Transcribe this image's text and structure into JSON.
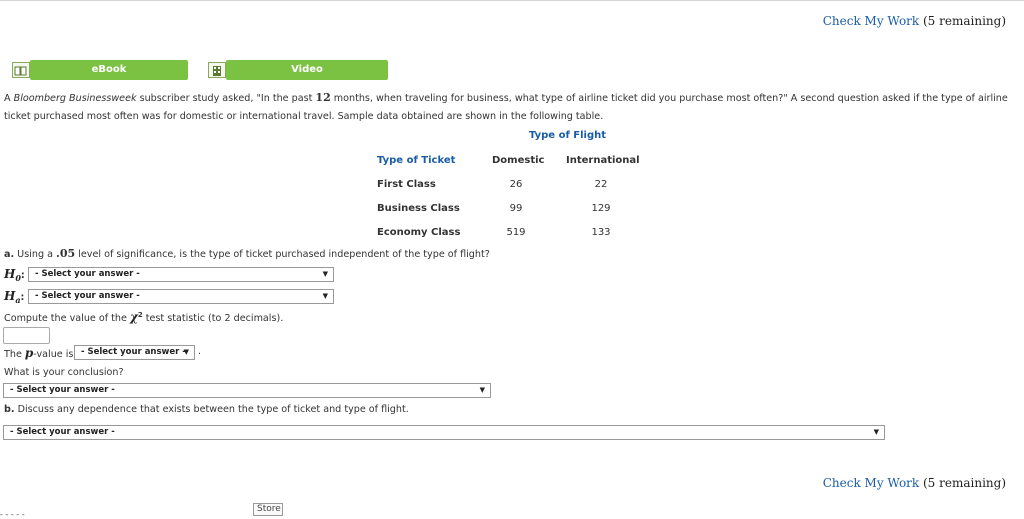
{
  "check_work": {
    "link": "Check My Work",
    "remaining": "(5 remaining)"
  },
  "resources": {
    "ebook": "eBook",
    "video": "Video"
  },
  "problem": {
    "intro_prefix": "A ",
    "publication": "Bloomberg Businessweek",
    "intro_mid": " subscriber study asked, \"In the past ",
    "months": "12",
    "intro_rest": " months, when traveling for business, what type of airline ticket did you purchase most often?\" A second question asked if the type of airline ticket purchased most often was for domestic or international travel. Sample data obtained are shown in the following table."
  },
  "table": {
    "group_header": "Type of Flight",
    "row_header": "Type of Ticket",
    "columns": [
      "Domestic",
      "International"
    ],
    "rows": [
      {
        "label": "First Class",
        "values": [
          "26",
          "22"
        ]
      },
      {
        "label": "Business Class",
        "values": [
          "99",
          "129"
        ]
      },
      {
        "label": "Economy Class",
        "values": [
          "519",
          "133"
        ]
      }
    ]
  },
  "part_a": {
    "letter": "a.",
    "question_pre": " Using a ",
    "alpha": ".05",
    "question_post": " level of significance, is the type of ticket purchased independent of the type of flight?",
    "h0_symbol": "H",
    "h0_sub": "0",
    "ha_symbol": "H",
    "ha_sub": "a",
    "h0_select": "- Select your answer -",
    "ha_select": "- Select your answer -",
    "chi_prompt_pre": "Compute the value of the ",
    "chi_symbol": "χ",
    "chi_sup": "2",
    "chi_prompt_post": " test statistic (to 2 decimals).",
    "chi_value": "",
    "pvalue_pre": "The ",
    "p_symbol": "p",
    "pvalue_post": "-value is",
    "pvalue_select": "- Select your answer -",
    "period": ".",
    "conclusion_prompt": "What is your conclusion?",
    "conclusion_select": "- Select your answer -"
  },
  "part_b": {
    "letter": "b.",
    "question": " Discuss any dependence that exists between the type of ticket and type of flight.",
    "select": "- Select your answer -"
  },
  "footer": {
    "store": "Store",
    "fragment": "- - - - -"
  }
}
